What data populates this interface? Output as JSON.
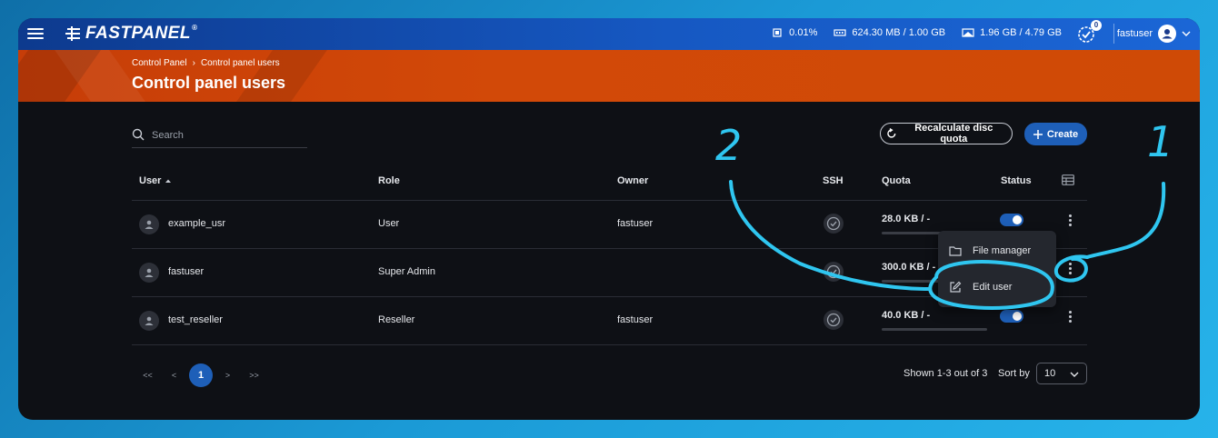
{
  "app": {
    "logo_text": "FASTPANEL",
    "logo_reg": "®"
  },
  "topbar": {
    "cpu": "0.01%",
    "ram": "624.30 MB / 1.00 GB",
    "disk": "1.96 GB / 4.79 GB",
    "notifications_count": "0",
    "username": "fastuser"
  },
  "banner": {
    "breadcrumb": [
      "Control Panel",
      "Control panel users"
    ],
    "breadcrumb_sep": "›",
    "title": "Control panel users"
  },
  "toolbar": {
    "search_placeholder": "Search",
    "recalc_label": "Recalculate disc quota",
    "create_label": "Create"
  },
  "table": {
    "columns": {
      "user": "User",
      "role": "Role",
      "owner": "Owner",
      "ssh": "SSH",
      "quota": "Quota",
      "status": "Status"
    },
    "rows": [
      {
        "user": "example_usr",
        "role": "User",
        "owner": "fastuser",
        "quota": "28.0 KB / -",
        "quota_fraction": 0.0,
        "status_on": true
      },
      {
        "user": "fastuser",
        "role": "Super Admin",
        "owner": "",
        "quota": "300.0 KB / -",
        "quota_fraction": 0.0,
        "status_on": true
      },
      {
        "user": "test_reseller",
        "role": "Reseller",
        "owner": "fastuser",
        "quota": "40.0 KB / -",
        "quota_fraction": 0.0,
        "status_on": true
      }
    ]
  },
  "context_menu": {
    "items": [
      {
        "label": "File manager",
        "icon": "folder-icon"
      },
      {
        "label": "Edit user",
        "icon": "edit-icon"
      }
    ]
  },
  "pagination": {
    "first": "<<",
    "prev": "<",
    "current": "1",
    "next": ">",
    "last": ">>",
    "shown": "Shown 1-3 out of 3",
    "sort_label": "Sort by",
    "per_page": "10"
  },
  "annotations": {
    "step1": "1",
    "step2": "2"
  },
  "colors": {
    "accent": "#1e5fb8",
    "banner": "#cf4a06",
    "annotation": "#2fc6f0",
    "background": "#0e1015"
  }
}
